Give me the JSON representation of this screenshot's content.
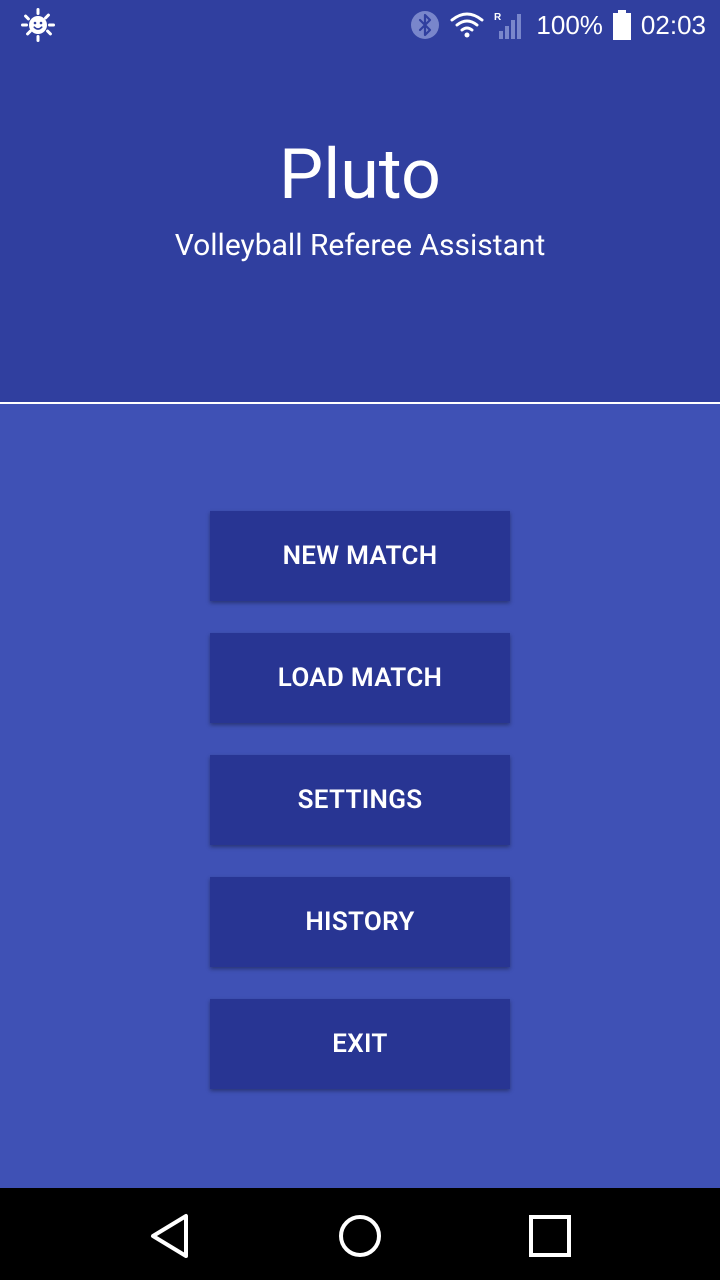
{
  "status_bar": {
    "battery_text": "100%",
    "time": "02:03",
    "icons": [
      "sun-smiley-icon",
      "bluetooth-icon",
      "wifi-icon",
      "signal-icon",
      "battery-icon"
    ]
  },
  "header": {
    "title": "Pluto",
    "subtitle": "Volleyball Referee Assistant"
  },
  "menu": {
    "new_match": "NEW MATCH",
    "load_match": "LOAD MATCH",
    "settings": "SETTINGS",
    "history": "HISTORY",
    "exit": "EXIT"
  },
  "nav_bar": {
    "icons": [
      "back-icon",
      "home-icon",
      "recents-icon"
    ]
  },
  "colors": {
    "header_bg": "#303f9f",
    "content_bg": "#3f51b5",
    "button_bg": "#283593",
    "text": "#ffffff",
    "nav_bg": "#000000"
  }
}
